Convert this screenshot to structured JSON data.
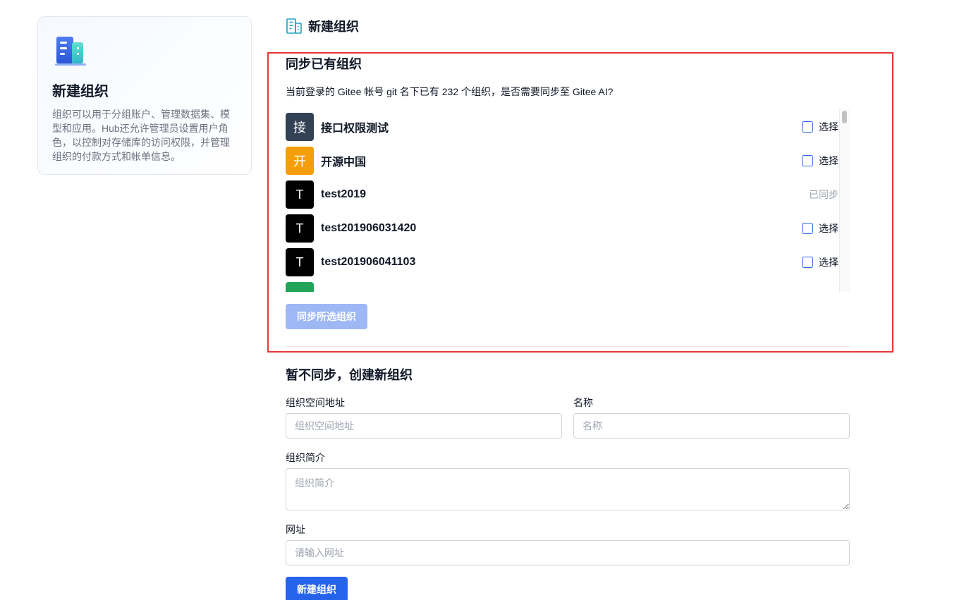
{
  "sidebar": {
    "icon": "building-icon",
    "title": "新建组织",
    "description": "组织可以用于分组账户、管理数据集、模型和应用。Hub还允许管理员设置用户角色，以控制对存储库的访问权限，并管理组织的付款方式和帐单信息。"
  },
  "header": {
    "icon": "building-outline-icon",
    "title": "新建组织"
  },
  "sync": {
    "title": "同步已有组织",
    "description": "当前登录的 Gitee 帐号 git 名下已有 232 个组织，是否需要同步至 Gitee AI?",
    "select_label": "选择",
    "synced_label": "已同步",
    "button_label": "同步所选组织",
    "orgs": [
      {
        "initial": "接",
        "name": "接口权限测试",
        "color": "#334155",
        "status": "select"
      },
      {
        "initial": "开",
        "name": "开源中国",
        "color": "#f59e0b",
        "status": "select"
      },
      {
        "initial": "T",
        "name": "test2019",
        "color": "#000000",
        "status": "synced"
      },
      {
        "initial": "T",
        "name": "test201906031420",
        "color": "#000000",
        "status": "select"
      },
      {
        "initial": "T",
        "name": "test201906041103",
        "color": "#000000",
        "status": "select"
      }
    ]
  },
  "create": {
    "title": "暂不同步，创建新组织",
    "namespace_label": "组织空间地址",
    "namespace_placeholder": "组织空间地址",
    "name_label": "名称",
    "name_placeholder": "名称",
    "intro_label": "组织简介",
    "intro_placeholder": "组织简介",
    "url_label": "网址",
    "url_placeholder": "请输入网址",
    "button_label": "新建组织"
  },
  "colors": {
    "primary": "#2563eb",
    "primary_disabled": "#9db8f5",
    "highlight": "#e53935"
  }
}
